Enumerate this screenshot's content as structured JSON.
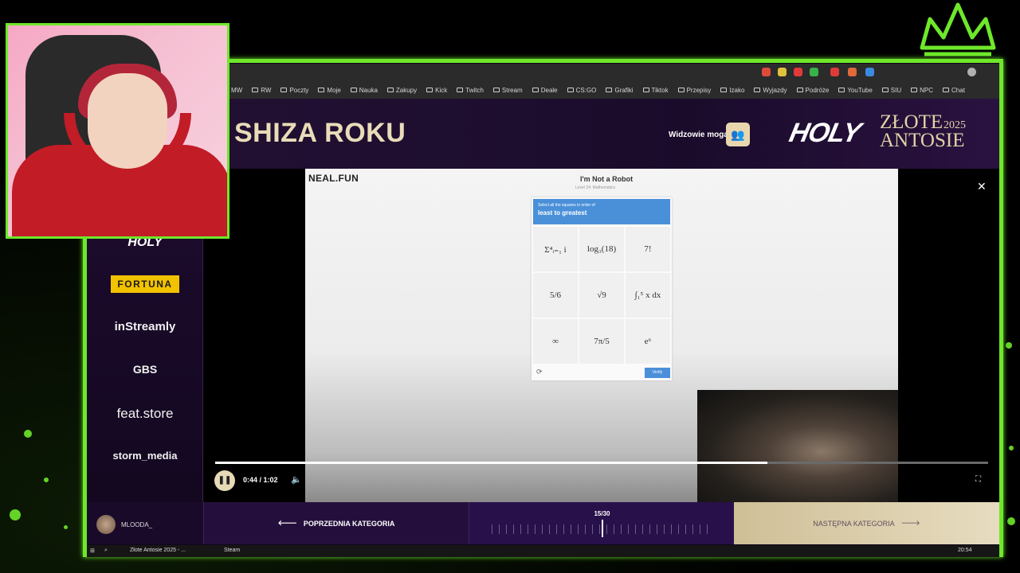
{
  "browser": {
    "bookmarks": [
      "MW",
      "RW",
      "Poczty",
      "Moje",
      "Nauka",
      "Zakupy",
      "Kick",
      "Twitch",
      "Stream",
      "Deale",
      "CS:GO",
      "Grafiki",
      "Tiktok",
      "Przepisy",
      "Izako",
      "Wyjazdy",
      "Podróże",
      "YouTube",
      "SIU",
      "NPC",
      "Chat"
    ]
  },
  "header": {
    "category_title": "SHIZA ROKU",
    "viewers_label": "Widzowie mogą",
    "logo_holy": "HOLY",
    "logo_awards": "ZŁOTE\nANTOSIE",
    "logo_year": "2025"
  },
  "sidebar": {
    "sponsors": [
      "HOLY",
      "FORTUNA",
      "inStreamly",
      "GBS",
      "feat.store",
      "storm_media"
    ]
  },
  "video": {
    "site_logo": "NEAL.FUN",
    "captcha_title": "I'm Not a Robot",
    "captcha_subtitle": "Level 24: Mathematics",
    "captcha_instruction": "Select all the squares in order of",
    "captcha_target": "least to greatest",
    "captcha_cells": [
      "Σ⁴ᵢ₌₁ i",
      "log₃(18)",
      "7!",
      "5/6",
      "√9",
      "∫₁⁵ x dx",
      "∞",
      "7π/5",
      "e⁶"
    ],
    "verify_label": "Verify",
    "progress_fraction": 0.714
  },
  "player": {
    "time": "0:44 / 1:02",
    "play_state": "pause-icon"
  },
  "bottom": {
    "user_name": "MLOODA_",
    "prev_label": "POPRZEDNIA KATEGORIA",
    "counter": "15/30",
    "counter_fraction": 0.5,
    "next_label": "NASTĘPNA KATEGORIA"
  },
  "taskbar": {
    "item_1": "Złote Antosie 2025 - ...",
    "item_2": "Steam",
    "clock": "20:54"
  },
  "colors": {
    "accent_green": "#6ee82a",
    "gold": "#e2d2a8",
    "purple": "#1a0a2a",
    "captcha_blue": "#4a90d9"
  }
}
